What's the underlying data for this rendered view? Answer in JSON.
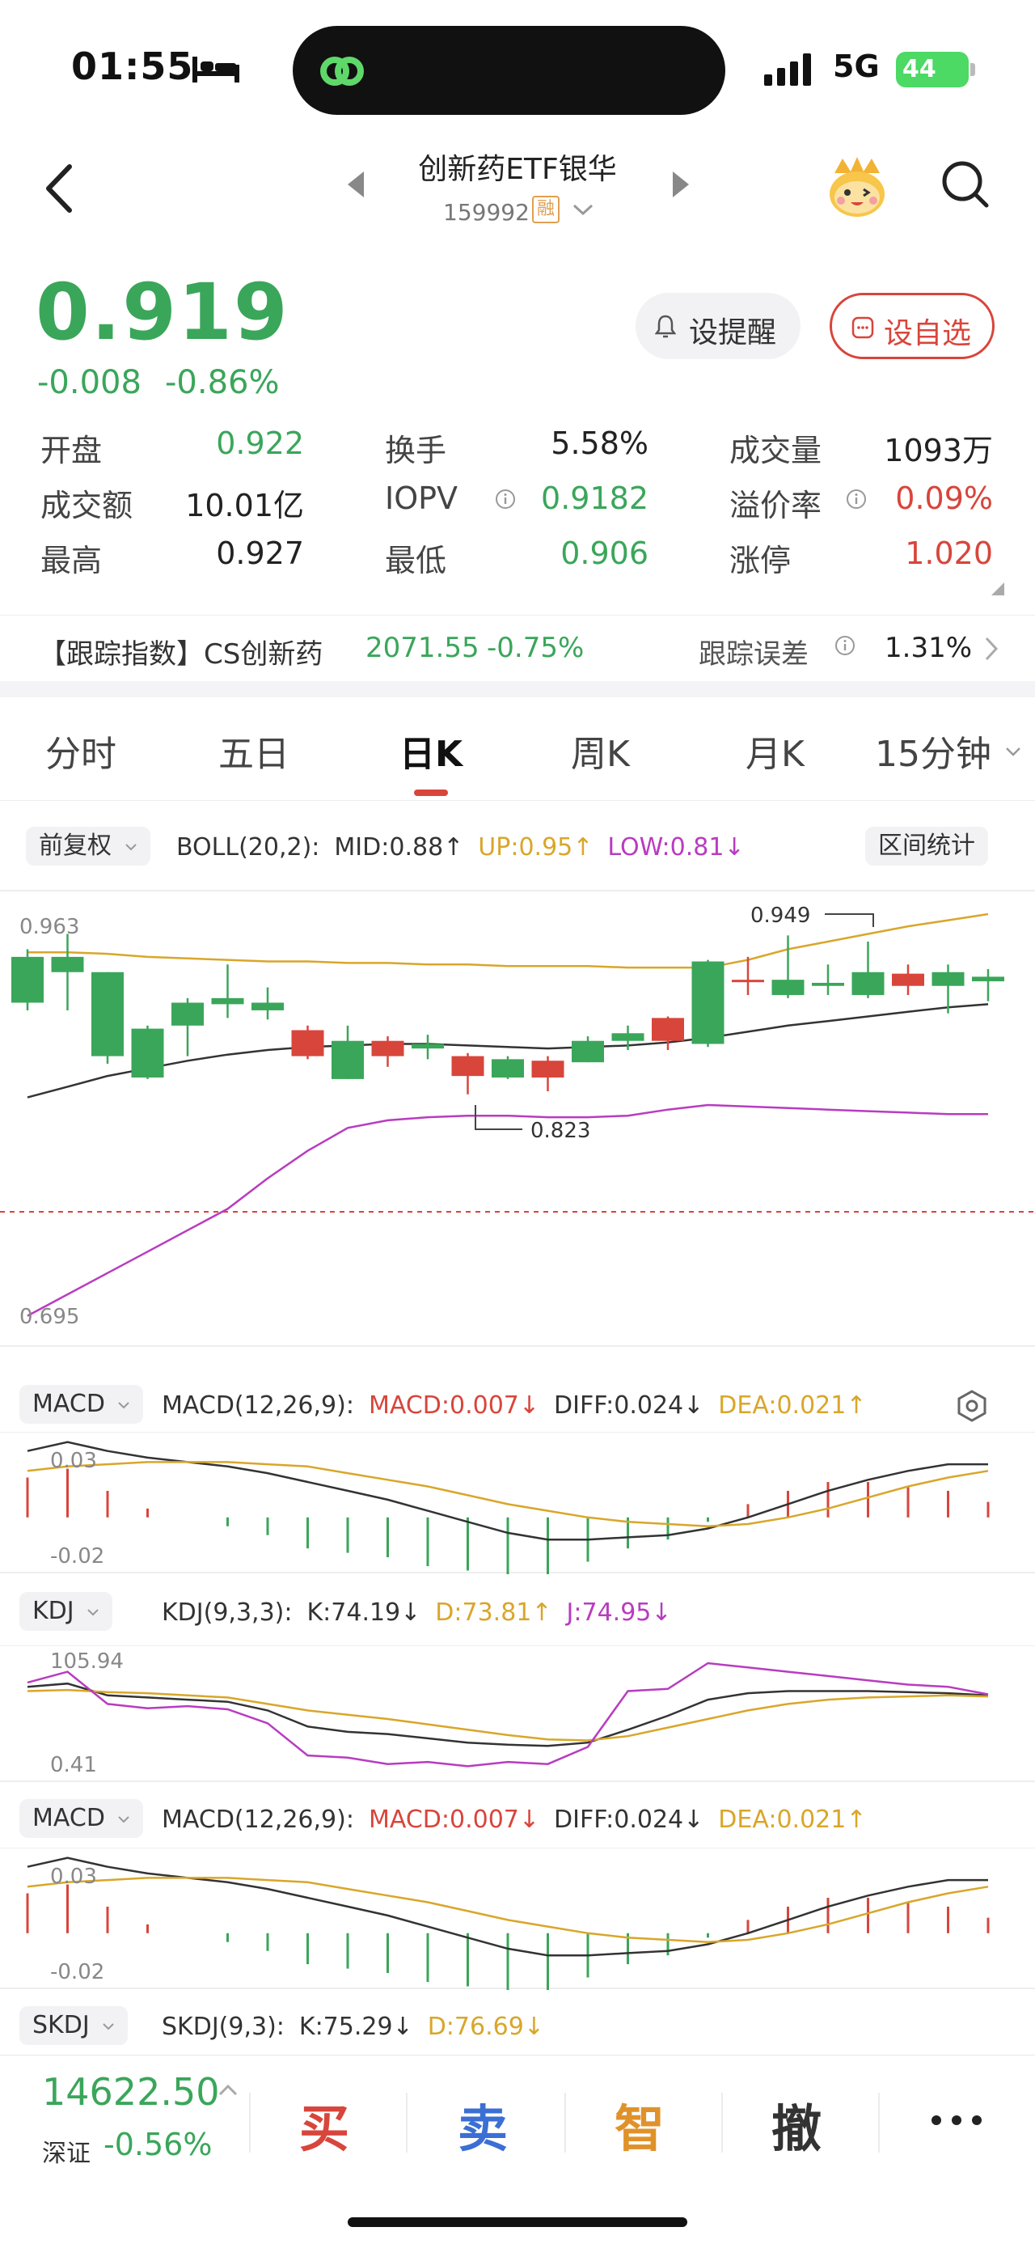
{
  "status_bar": {
    "time": "01:55",
    "network": "5G",
    "battery": "44"
  },
  "header": {
    "name": "创新药ETF银华",
    "code": "159992",
    "margin_badge": "融"
  },
  "quote": {
    "price": "0.919",
    "change": "-0.008",
    "change_pct": "-0.86%",
    "alert_label": "设提醒",
    "watch_label": "设自选",
    "stats": [
      {
        "label": "开盘",
        "value": "0.922",
        "color": "#3aa65a"
      },
      {
        "label": "换手",
        "value": "5.58%",
        "color": "#222222"
      },
      {
        "label": "成交量",
        "value": "1093万",
        "color": "#222222"
      },
      {
        "label": "成交额",
        "value": "10.01亿",
        "color": "#222222"
      },
      {
        "label": "IOPV",
        "value": "0.9182",
        "color": "#3aa65a"
      },
      {
        "label": "溢价率",
        "value": "0.09%",
        "color": "#d8453b"
      },
      {
        "label": "最高",
        "value": "0.927",
        "color": "#222222"
      },
      {
        "label": "最低",
        "value": "0.906",
        "color": "#3aa65a"
      },
      {
        "label": "涨停",
        "value": "1.020",
        "color": "#d8453b"
      }
    ]
  },
  "tracking": {
    "label": "【跟踪指数】CS创新药",
    "index_value": "2071.55",
    "index_pct": "-0.75%",
    "error_label": "跟踪误差",
    "error_value": "1.31%"
  },
  "tabs": [
    "分时",
    "五日",
    "日K",
    "周K",
    "月K",
    "15分钟"
  ],
  "active_tab": "日K",
  "boll": {
    "adjust": "前复权",
    "name": "BOLL(20,2):",
    "mid": "MID:0.88↑",
    "up": "UP:0.95↑",
    "low": "LOW:0.81↓",
    "range_stats": "区间统计",
    "y_top": "0.963",
    "y_bottom": "0.695",
    "high_label": "0.949",
    "low_label": "0.823"
  },
  "macd_panel_1": {
    "chip": "MACD",
    "name": "MACD(12,26,9):",
    "macd": "MACD:0.007↓",
    "diff": "DIFF:0.024↓",
    "dea": "DEA:0.021↑",
    "y_top": "0.03",
    "y_bottom": "-0.02"
  },
  "kdj_panel": {
    "chip": "KDJ",
    "name": "KDJ(9,3,3):",
    "k": "K:74.19↓",
    "d": "D:73.81↑",
    "j": "J:74.95↓",
    "y_top": "105.94",
    "y_bottom": "0.41"
  },
  "macd_panel_2": {
    "chip": "MACD",
    "name": "MACD(12,26,9):",
    "macd": "MACD:0.007↓",
    "diff": "DIFF:0.024↓",
    "dea": "DEA:0.021↑",
    "y_top": "0.03",
    "y_bottom": "-0.02"
  },
  "skdj_panel": {
    "chip": "SKDJ",
    "name": "SKDJ(9,3):",
    "k": "K:75.29↓",
    "d": "D:76.69↓"
  },
  "bottom": {
    "index_value": "14622.50",
    "index_name": "深证",
    "index_pct": "-0.56%",
    "buy": "买",
    "sell": "卖",
    "smart": "智",
    "cancel": "撤"
  },
  "colors": {
    "up": "#d8453b",
    "down": "#3aa65a",
    "mid_line": "#333333",
    "upper_band": "#d9a62a",
    "lower_band": "#b83cc0",
    "brand_red": "#d8453b"
  },
  "chart_data": {
    "type": "candlestick",
    "ylim": [
      0.695,
      0.963
    ],
    "candles": [
      {
        "open": 0.935,
        "close": 0.905,
        "high": 0.94,
        "low": 0.9
      },
      {
        "open": 0.935,
        "close": 0.925,
        "high": 0.95,
        "low": 0.9
      },
      {
        "open": 0.925,
        "close": 0.87,
        "high": 0.925,
        "low": 0.865
      },
      {
        "open": 0.888,
        "close": 0.856,
        "high": 0.89,
        "low": 0.855
      },
      {
        "open": 0.905,
        "close": 0.89,
        "high": 0.908,
        "low": 0.87
      },
      {
        "open": 0.908,
        "close": 0.904,
        "high": 0.93,
        "low": 0.895
      },
      {
        "open": 0.905,
        "close": 0.9,
        "high": 0.915,
        "low": 0.894
      },
      {
        "open": 0.87,
        "close": 0.887,
        "high": 0.89,
        "low": 0.868
      },
      {
        "open": 0.88,
        "close": 0.855,
        "high": 0.89,
        "low": 0.855
      },
      {
        "open": 0.87,
        "close": 0.88,
        "high": 0.883,
        "low": 0.863
      },
      {
        "open": 0.878,
        "close": 0.875,
        "high": 0.884,
        "low": 0.868
      },
      {
        "open": 0.857,
        "close": 0.87,
        "high": 0.872,
        "low": 0.845
      },
      {
        "open": 0.868,
        "close": 0.856,
        "high": 0.87,
        "low": 0.855
      },
      {
        "open": 0.856,
        "close": 0.867,
        "high": 0.87,
        "low": 0.847
      },
      {
        "open": 0.88,
        "close": 0.866,
        "high": 0.883,
        "low": 0.866
      },
      {
        "open": 0.885,
        "close": 0.88,
        "high": 0.89,
        "low": 0.874
      },
      {
        "open": 0.88,
        "close": 0.895,
        "high": 0.896,
        "low": 0.874
      },
      {
        "open": 0.932,
        "close": 0.878,
        "high": 0.933,
        "low": 0.876
      },
      {
        "open": 0.92,
        "close": 0.92,
        "high": 0.935,
        "low": 0.91
      },
      {
        "open": 0.92,
        "close": 0.91,
        "high": 0.949,
        "low": 0.908
      },
      {
        "open": 0.918,
        "close": 0.916,
        "high": 0.93,
        "low": 0.91
      },
      {
        "open": 0.925,
        "close": 0.91,
        "high": 0.945,
        "low": 0.908
      },
      {
        "open": 0.916,
        "close": 0.924,
        "high": 0.93,
        "low": 0.91
      },
      {
        "open": 0.925,
        "close": 0.916,
        "high": 0.93,
        "low": 0.898
      },
      {
        "open": 0.922,
        "close": 0.919,
        "high": 0.927,
        "low": 0.906
      }
    ],
    "series": [
      {
        "name": "MID",
        "values": [
          0.843,
          0.85,
          0.857,
          0.862,
          0.867,
          0.871,
          0.874,
          0.876,
          0.877,
          0.878,
          0.878,
          0.877,
          0.876,
          0.875,
          0.876,
          0.877,
          0.879,
          0.882,
          0.886,
          0.89,
          0.893,
          0.896,
          0.899,
          0.902,
          0.904
        ]
      },
      {
        "name": "UP",
        "values": [
          0.938,
          0.938,
          0.937,
          0.935,
          0.934,
          0.933,
          0.932,
          0.932,
          0.931,
          0.931,
          0.93,
          0.93,
          0.929,
          0.929,
          0.929,
          0.928,
          0.928,
          0.928,
          0.933,
          0.94,
          0.945,
          0.95,
          0.955,
          0.959,
          0.963
        ]
      },
      {
        "name": "LOW",
        "values": [
          0.7,
          0.714,
          0.728,
          0.742,
          0.756,
          0.77,
          0.79,
          0.808,
          0.823,
          0.828,
          0.83,
          0.831,
          0.831,
          0.83,
          0.83,
          0.831,
          0.835,
          0.838,
          0.837,
          0.836,
          0.835,
          0.834,
          0.833,
          0.832,
          0.832
        ]
      }
    ],
    "macd": {
      "ylim": [
        -0.022,
        0.035
      ],
      "diff": [
        0.03,
        0.034,
        0.03,
        0.027,
        0.025,
        0.023,
        0.02,
        0.016,
        0.012,
        0.008,
        0.003,
        -0.002,
        -0.007,
        -0.01,
        -0.01,
        -0.009,
        -0.008,
        -0.005,
        0.0,
        0.006,
        0.012,
        0.017,
        0.021,
        0.024,
        0.024
      ],
      "dea": [
        0.021,
        0.023,
        0.024,
        0.025,
        0.025,
        0.025,
        0.024,
        0.023,
        0.02,
        0.017,
        0.014,
        0.01,
        0.006,
        0.003,
        0.0,
        -0.002,
        -0.003,
        -0.004,
        -0.003,
        0.0,
        0.004,
        0.009,
        0.014,
        0.018,
        0.021
      ],
      "hist": [
        0.018,
        0.022,
        0.012,
        0.004,
        0.0,
        -0.004,
        -0.008,
        -0.014,
        -0.016,
        -0.018,
        -0.022,
        -0.024,
        -0.026,
        -0.026,
        -0.02,
        -0.014,
        -0.01,
        -0.002,
        0.006,
        0.012,
        0.016,
        0.016,
        0.014,
        0.012,
        0.007
      ]
    },
    "kdj": {
      "ylim": [
        0.41,
        105.94
      ],
      "k": [
        82,
        85,
        74,
        72,
        70,
        68,
        60,
        45,
        40,
        38,
        34,
        30,
        28,
        27,
        30,
        42,
        55,
        70,
        76,
        78,
        78,
        78,
        77,
        76,
        74
      ],
      "d": [
        78,
        79,
        77,
        76,
        74,
        72,
        66,
        60,
        56,
        52,
        47,
        42,
        37,
        33,
        32,
        36,
        44,
        52,
        60,
        66,
        70,
        72,
        73,
        74,
        73
      ],
      "j": [
        86,
        96,
        66,
        62,
        64,
        61,
        48,
        18,
        16,
        10,
        12,
        8,
        12,
        10,
        26,
        78,
        80,
        104,
        100,
        96,
        92,
        88,
        84,
        82,
        75
      ]
    },
    "skdj": {
      "k": "75.29",
      "d": "76.69"
    }
  }
}
